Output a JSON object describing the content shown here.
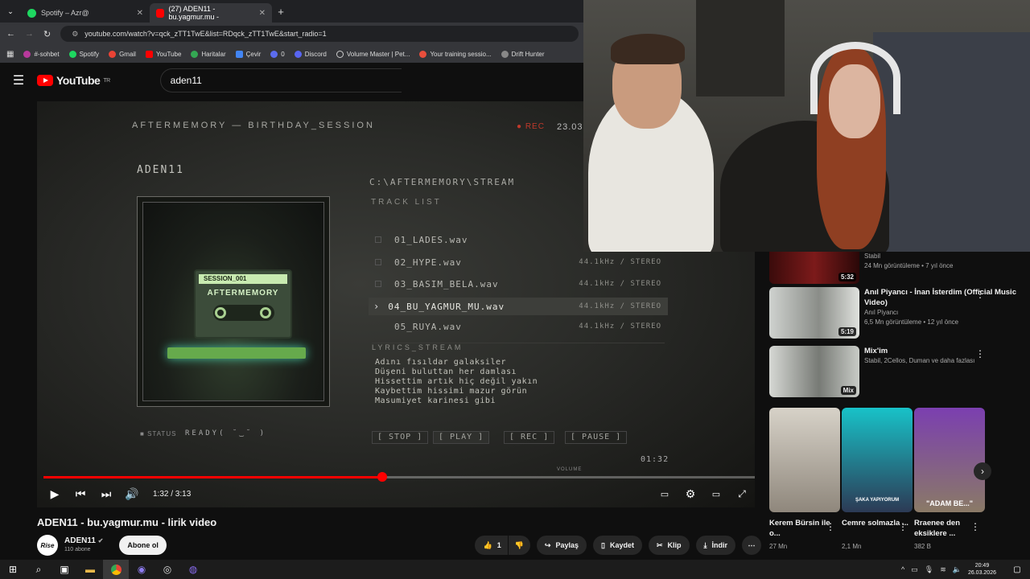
{
  "browser": {
    "tabs": [
      {
        "label": "Spotify – Azr@",
        "active": false
      },
      {
        "label": "(27) ADEN11 - bu.yagmur.mu -",
        "active": true
      }
    ],
    "url": "youtube.com/watch?v=qck_zTT1TwE&list=RDqck_zTT1TwE&start_radio=1",
    "bookmarks": [
      "#-sohbet",
      "Spotify",
      "Gmail",
      "YouTube",
      "Haritalar",
      "Çevir",
      "0",
      "Discord",
      "Volume Master | Pet...",
      "Your training sessio...",
      "Drift Hunter"
    ]
  },
  "youtube": {
    "logo": "YouTube",
    "logo_sup": "TR",
    "search_value": "aden11"
  },
  "video_scene": {
    "header_left": "AFTERMEMORY — BIRTHDAY_SESSION",
    "rec": "● REC",
    "date": "23.03",
    "artist": "ADEN11",
    "path": "C:\\AFTERMEMORY\\STREAM",
    "tracklist_label": "TRACK LIST",
    "cassette_label": "SESSION_001",
    "cassette_name": "AFTERMEMORY",
    "tracks": [
      {
        "name": "01_LADES.wav",
        "info": ""
      },
      {
        "name": "02_HYPE.wav",
        "info": "44.1kHz / STEREO"
      },
      {
        "name": "03_BASIM_BELA.wav",
        "info": "44.1kHz / STEREO"
      },
      {
        "name": "04_BU_YAGMUR_MU.wav",
        "info": "44.1kHz / STEREO"
      },
      {
        "name": "05_RUYA.wav",
        "info": "44.1kHz / STEREO"
      }
    ],
    "lyrics_label": "LYRICS_STREAM",
    "lyrics": [
      "Adını fısıldar galaksiler",
      "Düşeni buluttan her damlası",
      "Hissettim artık hiç değil yakın",
      "Kaybettim hissimi mazur görün",
      "Masumiyet karinesi gibi"
    ],
    "status_label": "STATUS",
    "status_value": "READY( ˘‿˘ )",
    "buttons": [
      "[ STOP ]",
      "[ PLAY ]",
      "[ REC ]",
      "[ PAUSE ]"
    ],
    "timer": "01:32",
    "volume_label": "VOLUME"
  },
  "player": {
    "time": "1:32 / 3:13",
    "progress": 0.4767
  },
  "video": {
    "title": "ADEN11 - bu.yagmur.mu - lirik video",
    "channel": "ADEN11",
    "subscribers": "110 abone",
    "avatar_text": "Rise",
    "subscribe": "Abone ol",
    "likes": "1",
    "share": "Paylaş",
    "save": "Kaydet",
    "clip": "Klip",
    "download": "İndir"
  },
  "sidebar": {
    "items": [
      {
        "title": "",
        "meta1": "Stabil",
        "meta2": "24 Mn görüntüleme • 7 yıl önce",
        "duration": "5:32"
      },
      {
        "title": "Anıl Piyancı - İnan İsterdim (Official Music Video)",
        "meta1": "Anıl Piyancı",
        "meta2": "6,5 Mn görüntüleme • 12 yıl önce",
        "duration": "5:19"
      },
      {
        "title": "Mix'im",
        "meta1": "Stabil, 2Cellos, Duman ve daha fazlası",
        "meta2": "",
        "duration": "Mix"
      }
    ],
    "shorts": [
      {
        "caption": "Kerem Bürsin ile o...",
        "views": "27 Mn",
        "overlay": ""
      },
      {
        "caption": "Cemre solmazla ...",
        "views": "2,1 Mn",
        "overlay": "ŞAKA YAPIYORUM"
      },
      {
        "caption": "Rraenee den eksiklere ...",
        "views": "382 B",
        "overlay": "\"ADAM BE...\""
      }
    ]
  },
  "taskbar": {
    "time": "20:49",
    "date": "26.03.2026"
  },
  "colors": {
    "accent": "#ff0000",
    "bg": "#0f0f0f"
  }
}
